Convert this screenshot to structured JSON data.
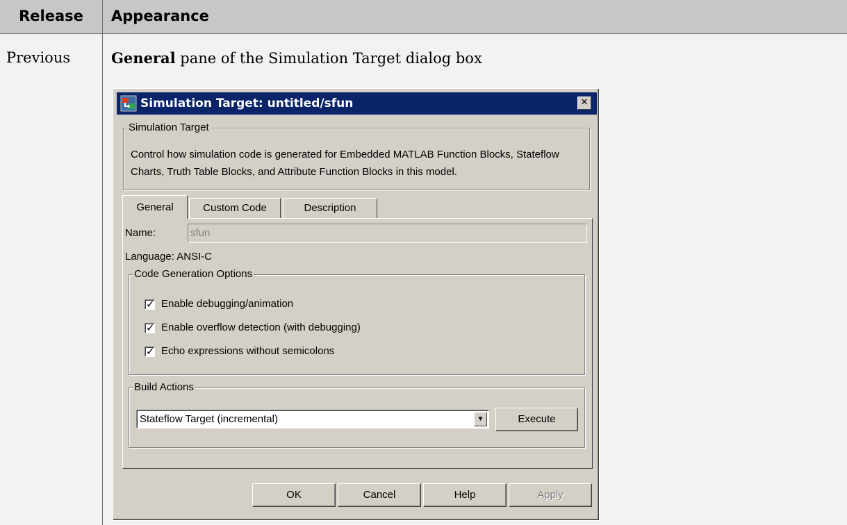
{
  "table": {
    "header_release": "Release",
    "header_appearance": "Appearance",
    "row_release": "Previous",
    "caption_bold": "General",
    "caption_rest": " pane of the Simulation Target dialog box"
  },
  "dialog": {
    "title": "Simulation Target: untitled/sfun",
    "close_glyph": "✕",
    "group_title": "Simulation Target",
    "description": "Control how simulation code is generated for Embedded MATLAB Function Blocks, Stateflow Charts, Truth Table Blocks, and Attribute Function Blocks in this model.",
    "tabs": [
      "General",
      "Custom Code",
      "Description"
    ],
    "name_label": "Name:",
    "name_value": "sfun",
    "language": "Language: ANSI-C",
    "code_gen_title": "Code Generation Options",
    "checkboxes": [
      {
        "label": "Enable debugging/animation",
        "checked": true
      },
      {
        "label": "Enable overflow detection (with debugging)",
        "checked": true
      },
      {
        "label": "Echo expressions without semicolons",
        "checked": true
      }
    ],
    "check_glyph": "✓",
    "build_title": "Build Actions",
    "build_selected": "Stateflow Target (incremental)",
    "execute_label": "Execute",
    "buttons": {
      "ok": "OK",
      "cancel": "Cancel",
      "help": "Help",
      "apply": "Apply"
    }
  }
}
